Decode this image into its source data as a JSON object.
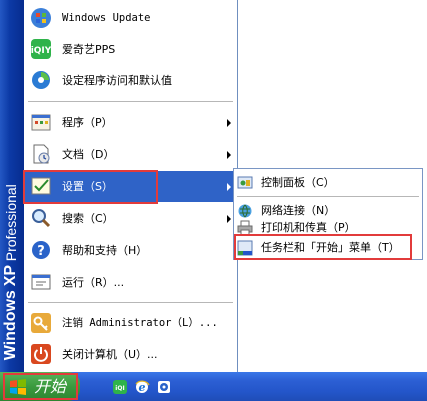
{
  "brand": {
    "windows": "Windows",
    "xp": "XP",
    "edition": "Professional"
  },
  "pinned": [
    {
      "label": "Windows Update",
      "icon": "windows-update-icon"
    },
    {
      "label": "爱奇艺PPS",
      "icon": "iqiyi-icon"
    },
    {
      "label": "设定程序访问和默认值",
      "icon": "program-defaults-icon"
    }
  ],
  "menu": [
    {
      "label": "程序（P）",
      "icon": "programs-icon",
      "submenu": true
    },
    {
      "label": "文档（D）",
      "icon": "documents-icon",
      "submenu": true
    },
    {
      "label": "设置（S）",
      "icon": "settings-icon",
      "submenu": true,
      "highlighted": true
    },
    {
      "label": "搜索（C）",
      "icon": "search-icon",
      "submenu": true
    },
    {
      "label": "帮助和支持（H）",
      "icon": "help-icon",
      "submenu": false
    },
    {
      "label": "运行（R）...",
      "icon": "run-icon",
      "submenu": false
    }
  ],
  "bottom": [
    {
      "label": "注销 Administrator（L）...",
      "icon": "logoff-icon"
    },
    {
      "label": "关闭计算机（U）...",
      "icon": "shutdown-icon"
    }
  ],
  "settings_submenu": [
    {
      "label": "控制面板（C）",
      "icon": "control-panel-icon"
    },
    {
      "label": "网络连接（N）",
      "icon": "network-connections-icon"
    },
    {
      "label": "打印机和传真（P）",
      "icon": "printers-faxes-icon"
    },
    {
      "label": "任务栏和「开始」菜单（T）",
      "icon": "taskbar-start-menu-icon"
    }
  ],
  "taskbar": {
    "start_label": "开始",
    "quick_launch": [
      "iqiyi-icon",
      "internet-explorer-icon",
      "media-icon"
    ]
  },
  "colors": {
    "highlight": "#2f63c7",
    "annotation": "#e23b3b",
    "start_button": "#3a9a3e",
    "taskbar": "#2355c9"
  }
}
